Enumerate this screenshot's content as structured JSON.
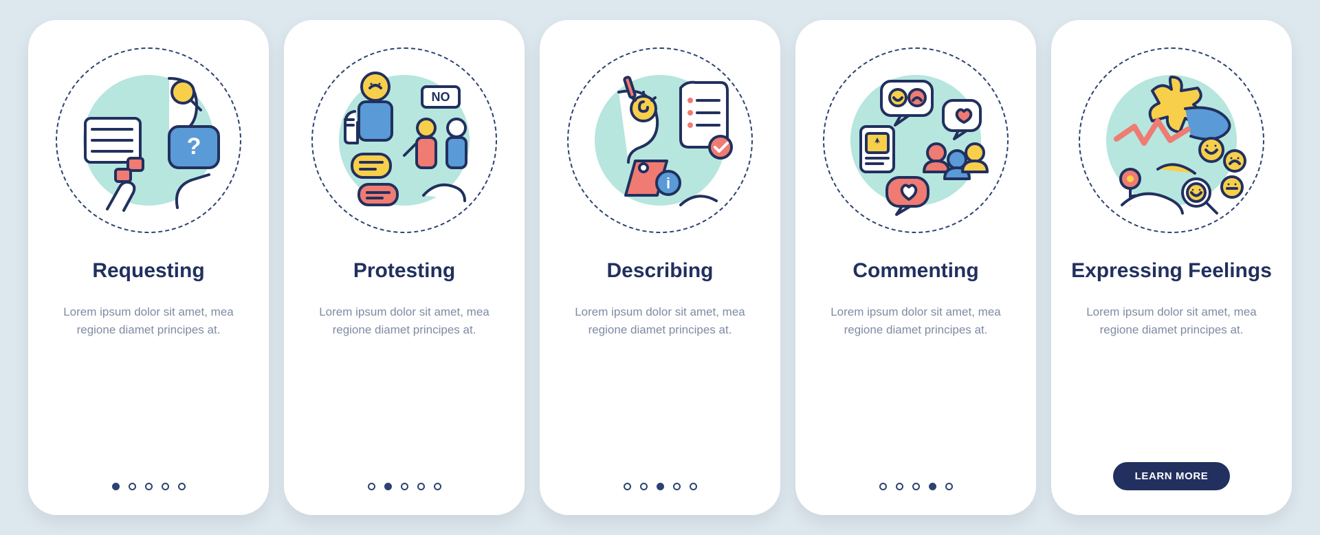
{
  "colors": {
    "navy": "#21305e",
    "coral": "#ef7b72",
    "yellow": "#f8cf4b",
    "blue": "#5a9ad6",
    "mint": "#b6e6de",
    "bg": "#dde7ee"
  },
  "learn_more_label": "LEARN MORE",
  "body_text": "Lorem ipsum dolor sit amet, mea regione diamet principes at.",
  "cards": [
    {
      "title": "Requesting",
      "active_index": 0,
      "has_button": false,
      "icon": "requesting-icon"
    },
    {
      "title": "Protesting",
      "active_index": 1,
      "has_button": false,
      "icon": "protesting-icon"
    },
    {
      "title": "Describing",
      "active_index": 2,
      "has_button": false,
      "icon": "describing-icon"
    },
    {
      "title": "Commenting",
      "active_index": 3,
      "has_button": false,
      "icon": "commenting-icon"
    },
    {
      "title": "Expressing Feelings",
      "active_index": 4,
      "has_button": true,
      "icon": "expressing-feelings-icon"
    }
  ]
}
